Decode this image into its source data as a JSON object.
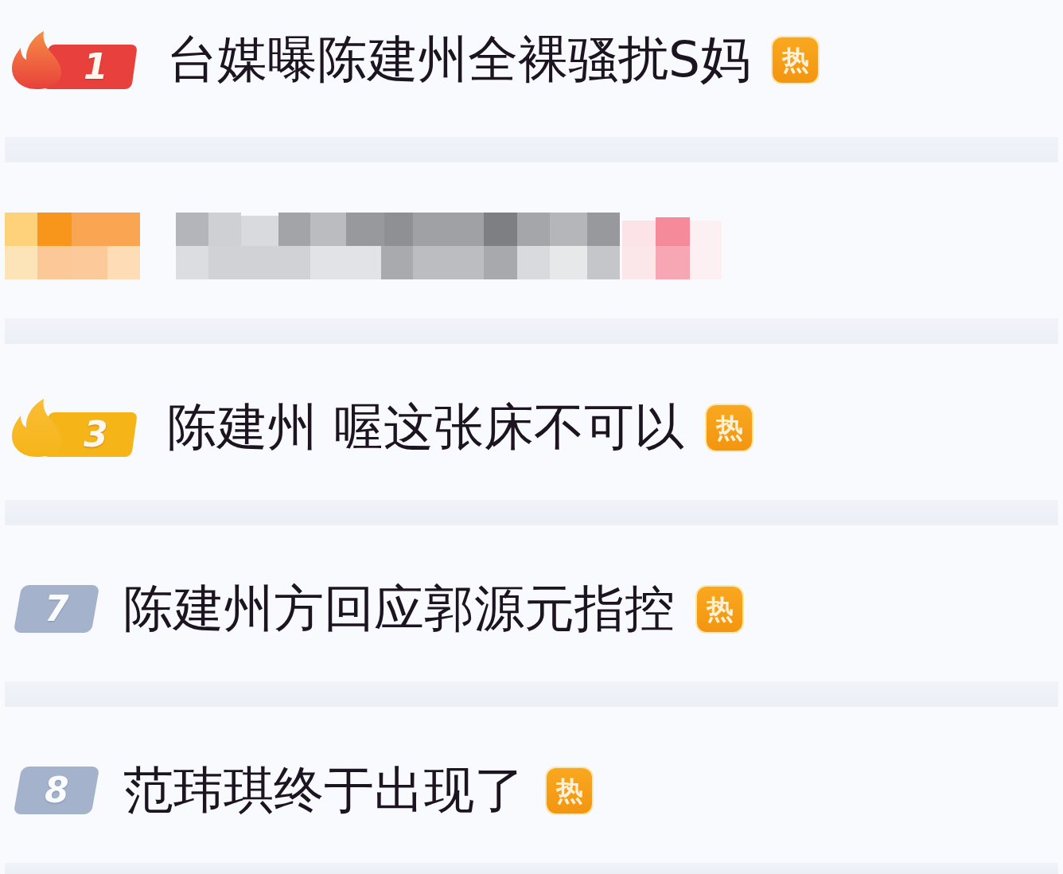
{
  "topics": [
    {
      "kind": "ranked",
      "rank_badge": {
        "kind": "flame",
        "color": "#e8403c",
        "label": "1"
      },
      "title": "台媒曝陈建州全裸骚扰S妈",
      "tag": "热"
    },
    {
      "kind": "censored"
    },
    {
      "kind": "ranked",
      "rank_badge": {
        "kind": "flame",
        "color": "#f5b518",
        "label": "3"
      },
      "title": "陈建州 喔这张床不可以",
      "tag": "热"
    },
    {
      "kind": "ranked",
      "rank_badge": {
        "kind": "plain",
        "color": "#a4b3cb",
        "label": "7"
      },
      "title": "陈建州方回应郭源元指控",
      "tag": "热"
    },
    {
      "kind": "ranked",
      "rank_badge": {
        "kind": "plain",
        "color": "#a4b3cb",
        "label": "8"
      },
      "title": "范玮琪终于出现了",
      "tag": "热"
    }
  ]
}
